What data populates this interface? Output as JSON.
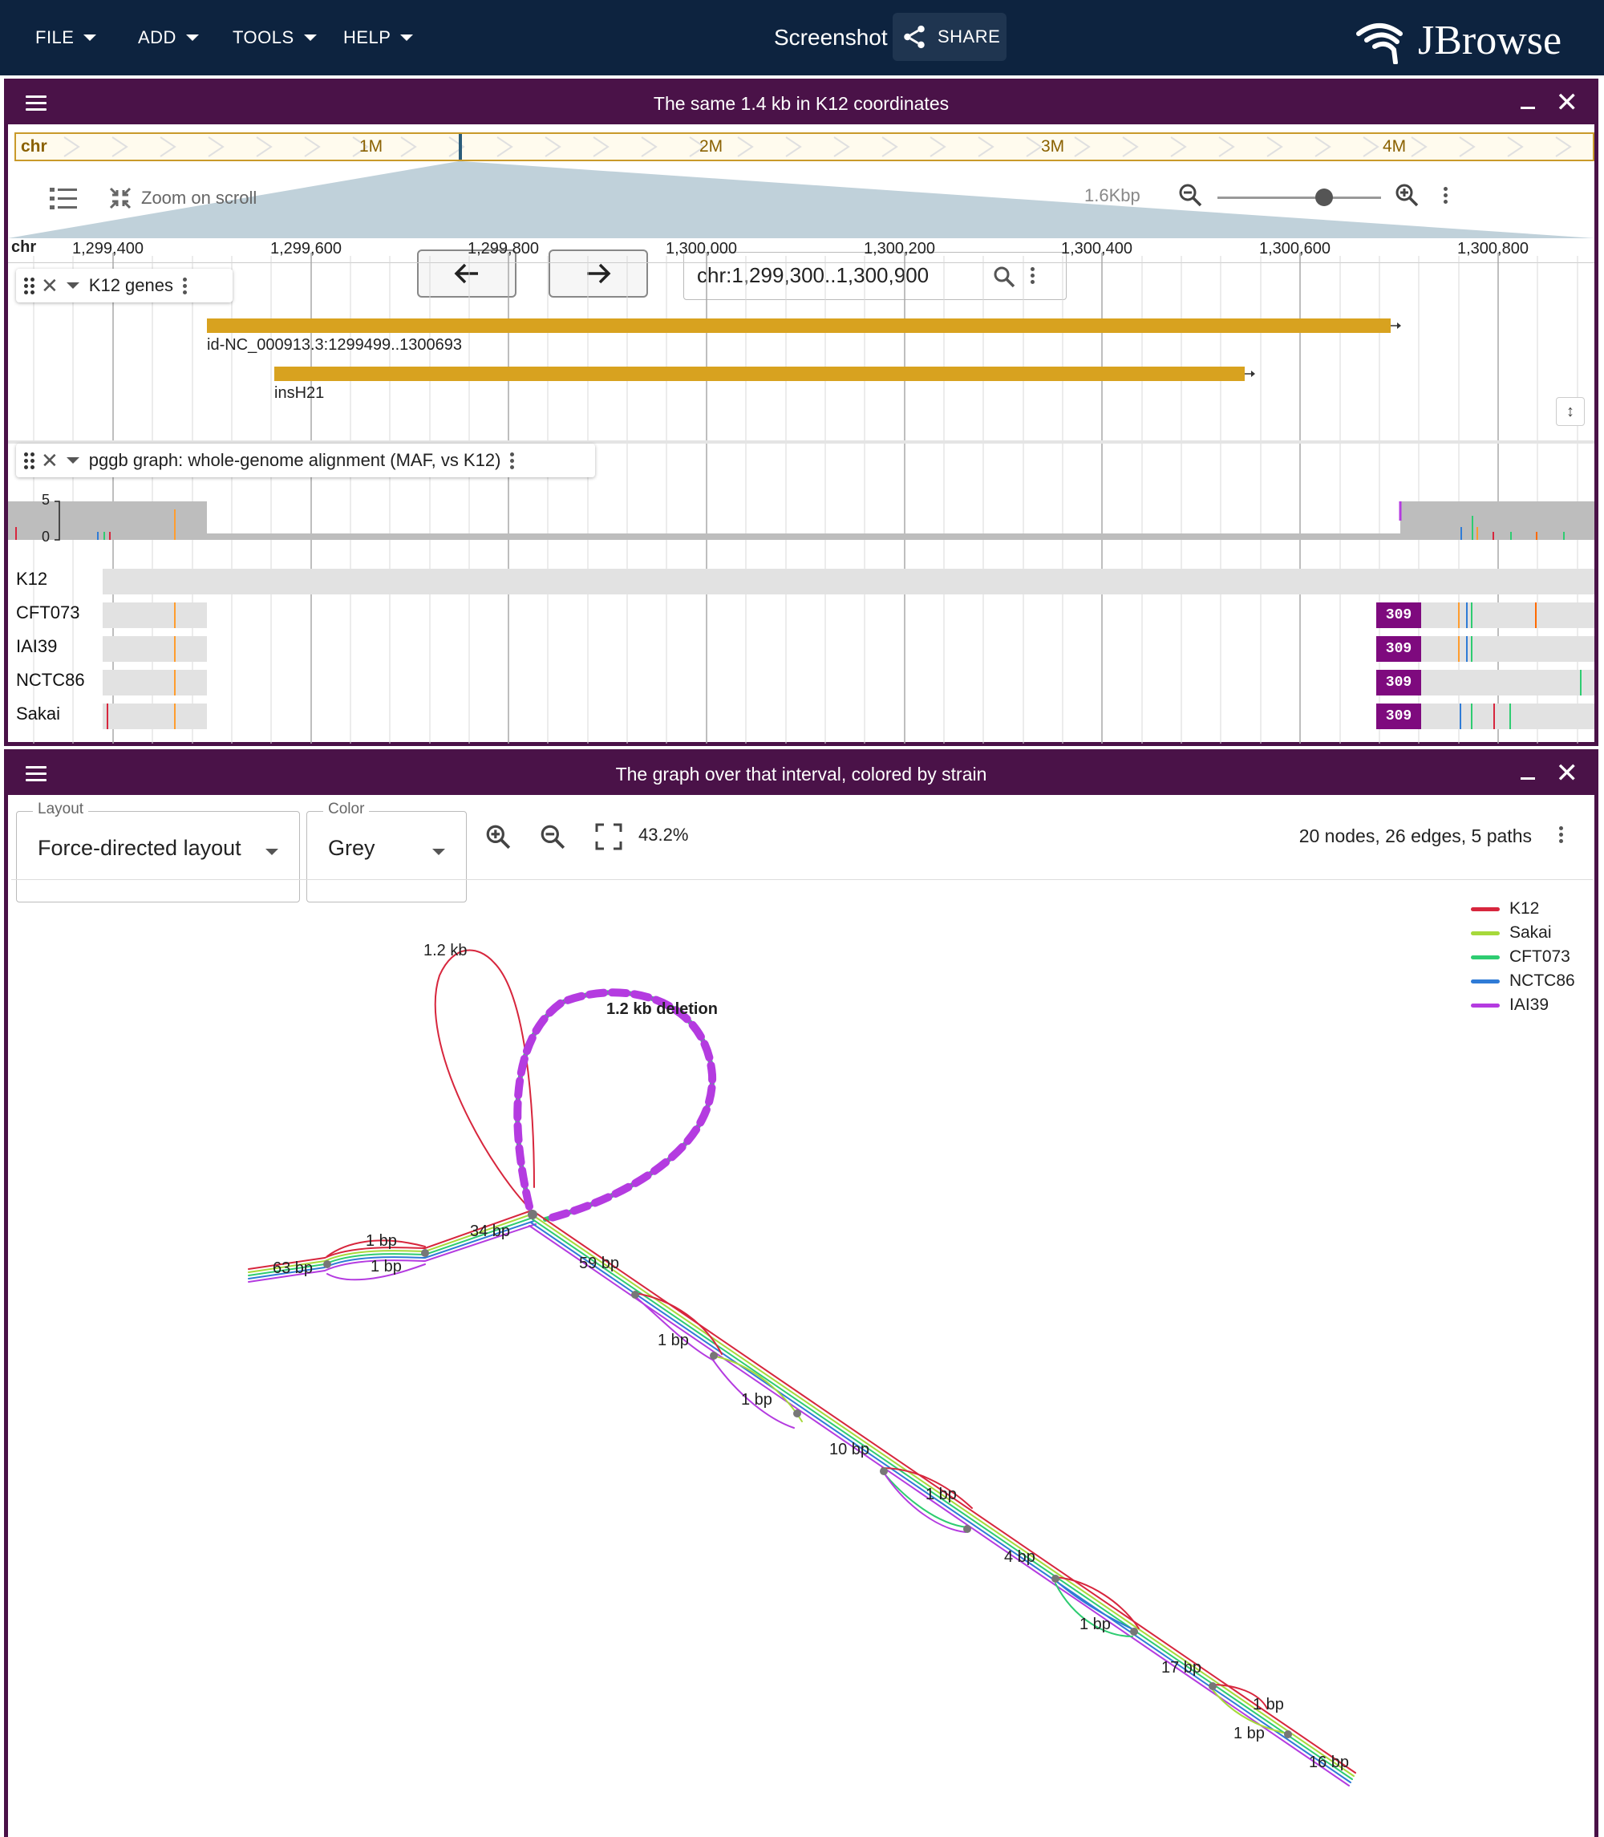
{
  "appbar": {
    "menus": [
      {
        "label": "FILE"
      },
      {
        "label": "ADD"
      },
      {
        "label": "TOOLS"
      },
      {
        "label": "HELP"
      }
    ],
    "title": "Screenshot",
    "share_label": "SHARE",
    "logo_text": "JBrowse"
  },
  "linear_view": {
    "title": "The same 1.4 kb in K12 coordinates",
    "overview": {
      "ref_name": "chr",
      "ticks": [
        "1M",
        "2M",
        "3M",
        "4M"
      ]
    },
    "toolbar": {
      "zoom_on_scroll": "Zoom on scroll",
      "location": "chr:1,299,300..1,300,900",
      "span": "1.6Kbp",
      "zoom_level_fraction": 0.65
    },
    "ruler": {
      "ref_name": "chr",
      "ticks": [
        "1,299,400",
        "1,299,600",
        "1,299,800",
        "1,300,000",
        "1,300,200",
        "1,300,400",
        "1,300,600",
        "1,300,800"
      ]
    },
    "gene_track": {
      "name": "K12 genes",
      "features": [
        {
          "label": "id-NC_000913.3:1299499..1300693",
          "start": 1299499,
          "end": 1300693
        },
        {
          "label": "insH21",
          "start": 1299567,
          "end": 1300605
        }
      ]
    },
    "alignment_track": {
      "name": "pggb graph: whole-genome alignment (MAF, vs K12)",
      "y_axis_max": "5",
      "y_axis_min": "0",
      "rows": [
        {
          "name": "K12",
          "badge": ""
        },
        {
          "name": "CFT073",
          "badge": "309"
        },
        {
          "name": "IAI39",
          "badge": "309"
        },
        {
          "name": "NCTC86",
          "badge": "309"
        },
        {
          "name": "Sakai",
          "badge": "309"
        }
      ]
    }
  },
  "graph_view": {
    "title": "The graph over that interval, colored by strain",
    "layout_label": "Layout",
    "layout_value": "Force-directed layout",
    "color_label": "Color",
    "color_value": "Grey",
    "zoom_percent": "43.2%",
    "stats": "20 nodes, 26 edges, 5 paths",
    "legend": [
      {
        "name": "K12",
        "color": "#d7263d"
      },
      {
        "name": "Sakai",
        "color": "#a6d93a"
      },
      {
        "name": "CFT073",
        "color": "#2ecc71"
      },
      {
        "name": "NCTC86",
        "color": "#2f7bd6"
      },
      {
        "name": "IAI39",
        "color": "#b43be0"
      }
    ],
    "node_labels": {
      "n_1_2kb": "1.2 kb",
      "deletion": "1.2 kb deletion",
      "n_63bp": "63 bp",
      "n_1bp_a": "1 bp",
      "n_1bp_b": "1 bp",
      "n_34bp": "34 bp",
      "n_59bp": "59 bp",
      "n_1bp_c": "1 bp",
      "n_1bp_d": "1 bp",
      "n_10bp": "10 bp",
      "n_1bp_e": "1 bp",
      "n_4bp": "4 bp",
      "n_1bp_f": "1 bp",
      "n_17bp": "17 bp",
      "n_1bp_g": "1 bp",
      "n_1bp_h": "1 bp",
      "n_16bp": "16 bp"
    }
  }
}
